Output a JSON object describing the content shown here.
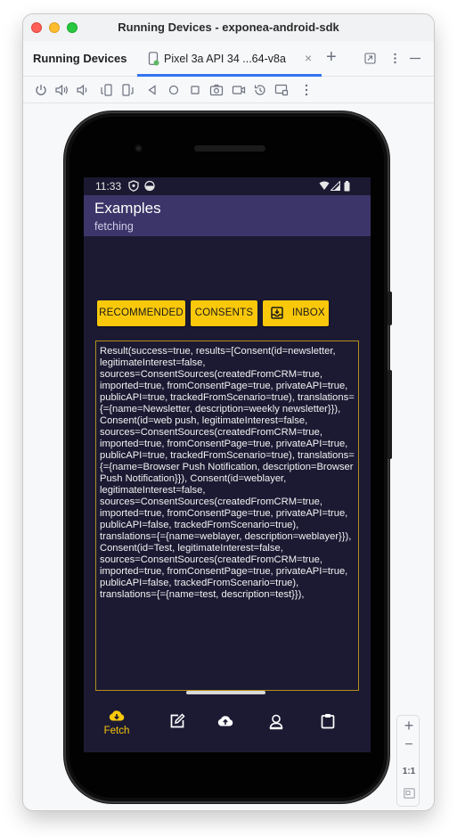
{
  "window": {
    "title": "Running Devices - exponea-android-sdk"
  },
  "tool_window": {
    "title": "Running Devices",
    "tab_label": "Pixel 3a API 34 ...64-v8a",
    "tab_close": "×",
    "tab_add": "+",
    "header_icons": [
      "restore-layout-icon",
      "more-vertical-icon",
      "minimize-icon"
    ]
  },
  "device_toolbar": {
    "icons": [
      "power-icon",
      "volume-up-icon",
      "volume-down-icon",
      "rotate-left-icon",
      "rotate-right-icon",
      "back-icon",
      "home-icon",
      "overview-icon",
      "screenshot-icon",
      "screen-record-icon",
      "snapshot-icon",
      "device-frame-icon",
      "more-vertical-icon"
    ]
  },
  "phone": {
    "status": {
      "time": "11:33"
    },
    "app_bar": {
      "title": "Examples",
      "subtitle": "fetching"
    },
    "buttons": {
      "recommended": "RECOMMENDED",
      "consents": "CONSENTS",
      "inbox": "INBOX"
    },
    "result_text": "Result(success=true, results=[Consent(id=newsletter, legitimateInterest=false, sources=ConsentSources(createdFromCRM=true, imported=true, fromConsentPage=true, privateAPI=true, publicAPI=true, trackedFromScenario=true), translations={={name=Newsletter, description=weekly newsletter}}), Consent(id=web push, legitimateInterest=false, sources=ConsentSources(createdFromCRM=true, imported=true, fromConsentPage=true, privateAPI=true, publicAPI=true, trackedFromScenario=true), translations={={name=Browser Push Notification, description=Browser Push Notification}}), Consent(id=weblayer, legitimateInterest=false, sources=ConsentSources(createdFromCRM=true, imported=true, fromConsentPage=true, privateAPI=true, publicAPI=false, trackedFromScenario=true), translations={={name=weblayer, description=weblayer}}), Consent(id=Test, legitimateInterest=false, sources=ConsentSources(createdFromCRM=true, imported=true, fromConsentPage=true, privateAPI=true, publicAPI=false, trackedFromScenario=true), translations={={name=test, description=test}}),",
    "bottom_nav": {
      "fetch_label": "Fetch",
      "items": [
        "cloud-download-icon",
        "edit-icon",
        "cloud-upload-icon",
        "user-icon",
        "clipboard-icon"
      ],
      "active_color": "#f9c80b"
    },
    "accent_color": "#f9c80b",
    "app_bar_color": "#3c3569"
  },
  "zoom_panel": {
    "zoom_in": "+",
    "zoom_out": "−",
    "actual_size": "1:1"
  }
}
